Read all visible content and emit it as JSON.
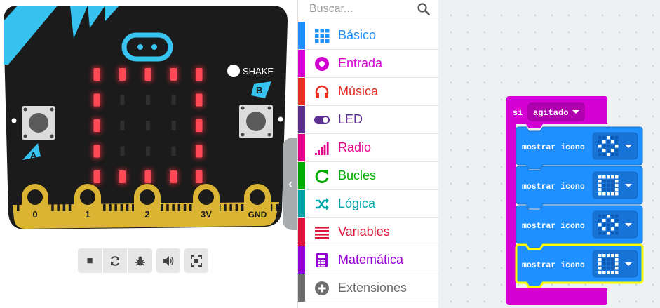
{
  "simulator": {
    "shake_label": "SHAKE",
    "button_a_label": "A",
    "button_b_label": "B",
    "pin_labels": [
      "0",
      "1",
      "2",
      "3V",
      "GND"
    ],
    "led_matrix": [
      [
        1,
        1,
        1,
        1,
        1
      ],
      [
        1,
        0,
        0,
        0,
        1
      ],
      [
        1,
        0,
        0,
        0,
        1
      ],
      [
        1,
        0,
        0,
        0,
        1
      ],
      [
        1,
        1,
        1,
        1,
        1
      ]
    ],
    "led_on_color": "#ff2b3d",
    "board_color": "#1b1b1b",
    "accent_color": "#37c3ef",
    "toolbar": [
      {
        "name": "stop-icon",
        "glyph": "■"
      },
      {
        "name": "restart-icon",
        "glyph": "⟳"
      },
      {
        "name": "debug-icon",
        "glyph": "✱"
      },
      {
        "name": "mute-icon",
        "glyph": "🔈"
      },
      {
        "name": "fullscreen-icon",
        "glyph": "⛶"
      }
    ]
  },
  "toolbox": {
    "search_placeholder": "Buscar...",
    "categories": [
      {
        "label": "Básico",
        "color": "#1e90ff",
        "icon": "grid-icon"
      },
      {
        "label": "Entrada",
        "color": "#d400d4",
        "icon": "target-icon"
      },
      {
        "label": "Música",
        "color": "#e63022",
        "icon": "headphones-icon"
      },
      {
        "label": "LED",
        "color": "#5c2d91",
        "icon": "toggle-icon"
      },
      {
        "label": "Radio",
        "color": "#e3008c",
        "icon": "signal-icon"
      },
      {
        "label": "Bucles",
        "color": "#00aa00",
        "icon": "refresh-icon"
      },
      {
        "label": "Lógica",
        "color": "#00a4a6",
        "icon": "shuffle-icon"
      },
      {
        "label": "Variables",
        "color": "#dc143c",
        "icon": "list-icon"
      },
      {
        "label": "Matemática",
        "color": "#9400d3",
        "icon": "calculator-icon"
      },
      {
        "label": "Extensiones",
        "color": "#6e6e6e",
        "icon": "plus-icon"
      }
    ]
  },
  "workspace": {
    "event_keyword": "si",
    "event_dropdown": "agitado",
    "event_color": "#d400d4",
    "statement_color": "#1e90ff",
    "statements": [
      {
        "label": "mostrar icono",
        "icon": "diamond"
      },
      {
        "label": "mostrar icono",
        "icon": "square"
      },
      {
        "label": "mostrar icono",
        "icon": "diamond"
      },
      {
        "label": "mostrar icono",
        "icon": "square",
        "selected": true
      }
    ],
    "icon_patterns": {
      "diamond": [
        [
          0,
          0,
          1,
          0,
          0
        ],
        [
          0,
          1,
          0,
          1,
          0
        ],
        [
          1,
          0,
          0,
          0,
          1
        ],
        [
          0,
          1,
          0,
          1,
          0
        ],
        [
          0,
          0,
          1,
          0,
          0
        ]
      ],
      "square": [
        [
          1,
          1,
          1,
          1,
          1
        ],
        [
          1,
          0,
          0,
          0,
          1
        ],
        [
          1,
          0,
          0,
          0,
          1
        ],
        [
          1,
          0,
          0,
          0,
          1
        ],
        [
          1,
          1,
          1,
          1,
          1
        ]
      ]
    },
    "selected_color": "#ffff00"
  }
}
